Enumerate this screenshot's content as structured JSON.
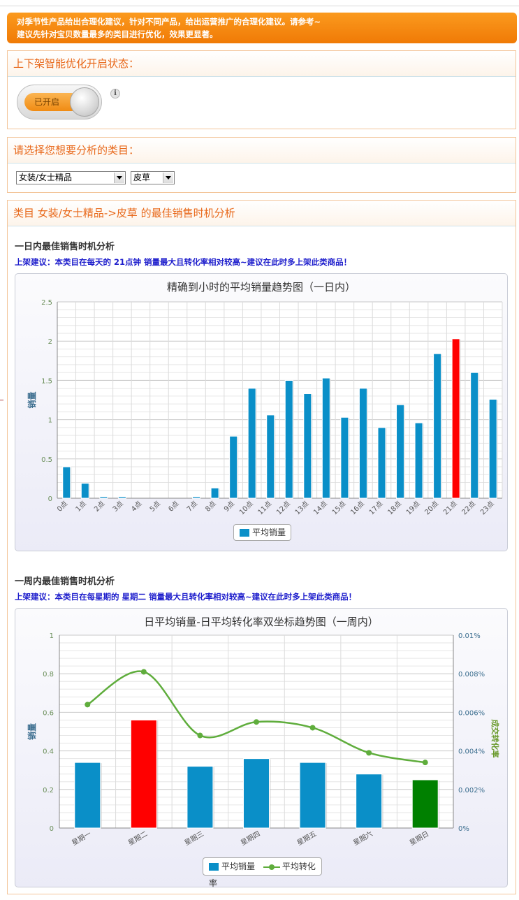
{
  "notice": {
    "line1": "对季节性产品给出合理化建议，针对不同产品，给出运营推广的合理化建议。请参考~",
    "line2": "建议先针对宝贝数量最多的类目进行优化，效果更显著。"
  },
  "status_panel": {
    "title": "上下架智能优化开启状态：",
    "toggle_label": "已开启",
    "info_icon": "i"
  },
  "category_panel": {
    "title": "请选择您想要分析的类目：",
    "category_select": "女装/女士精品",
    "subcategory_select": "皮草"
  },
  "analysis_panel": {
    "title": "类目  女装/女士精品->皮草  的最佳销售时机分析",
    "day_section": {
      "heading": "一日内最佳销售时机分析",
      "advice": "上架建议：本类目在每天的 21点钟 销量最大且转化率相对较高~建议在此时多上架此类商品！"
    },
    "week_section": {
      "heading": "一周内最佳销售时机分析",
      "advice": "上架建议：本类目在每星期的 星期二 销量最大且转化率相对较高~建议在此时多上架此类商品！"
    }
  },
  "chart_data": [
    {
      "type": "bar",
      "title": "精确到小时的平均销量趋势图（一日内）",
      "ylabel": "销量",
      "xlabel": "",
      "ylim": [
        0,
        2.5
      ],
      "yticks": [
        "0",
        "0.5",
        "1",
        "1.5",
        "2",
        "2.5"
      ],
      "grid": true,
      "legend": "bottom-center",
      "categories": [
        "0点",
        "1点",
        "2点",
        "3点",
        "4点",
        "5点",
        "6点",
        "7点",
        "8点",
        "9点",
        "10点",
        "11点",
        "12点",
        "13点",
        "14点",
        "15点",
        "16点",
        "17点",
        "18点",
        "19点",
        "20点",
        "21点",
        "22点",
        "23点"
      ],
      "series": [
        {
          "name": "平均销量",
          "values": [
            0.4,
            0.19,
            0.02,
            0.02,
            0,
            0,
            0,
            0.02,
            0.13,
            0.79,
            1.4,
            1.06,
            1.5,
            1.33,
            1.53,
            1.03,
            1.4,
            0.9,
            1.19,
            0.96,
            1.84,
            2.03,
            1.6,
            1.26
          ],
          "color": "#0a8fc8",
          "highlight_index": 21,
          "highlight_color": "#ff0000"
        }
      ]
    },
    {
      "type": "bar",
      "title": "日平均销量-日平均转化率双坐标趋势图（一周内）",
      "ylabel": "销量",
      "y2label": "成交转化率",
      "ylim": [
        0,
        1
      ],
      "y2lim": [
        0,
        0.01
      ],
      "yticks": [
        "0",
        "0.2",
        "0.4",
        "0.6",
        "0.8",
        "1"
      ],
      "y2ticks": [
        "0%",
        "0.002%",
        "0.004%",
        "0.006%",
        "0.008%",
        "0.01%"
      ],
      "grid": true,
      "legend": "bottom-center",
      "categories": [
        "星期一",
        "星期二",
        "星期三",
        "星期四",
        "星期五",
        "星期六",
        "星期日"
      ],
      "series": [
        {
          "name": "平均销量",
          "type": "bar",
          "values": [
            0.34,
            0.56,
            0.32,
            0.36,
            0.34,
            0.28,
            0.25
          ],
          "color": "#0a8fc8",
          "bar_colors": [
            "#0a8fc8",
            "#ff0000",
            "#0a8fc8",
            "#0a8fc8",
            "#0a8fc8",
            "#0a8fc8",
            "#008000"
          ]
        },
        {
          "name": "平均转化率",
          "type": "line",
          "axis": "right",
          "values": [
            0.0064,
            0.0081,
            0.0048,
            0.0055,
            0.0052,
            0.0039,
            0.0034
          ],
          "color": "#5fad3c"
        }
      ]
    }
  ]
}
